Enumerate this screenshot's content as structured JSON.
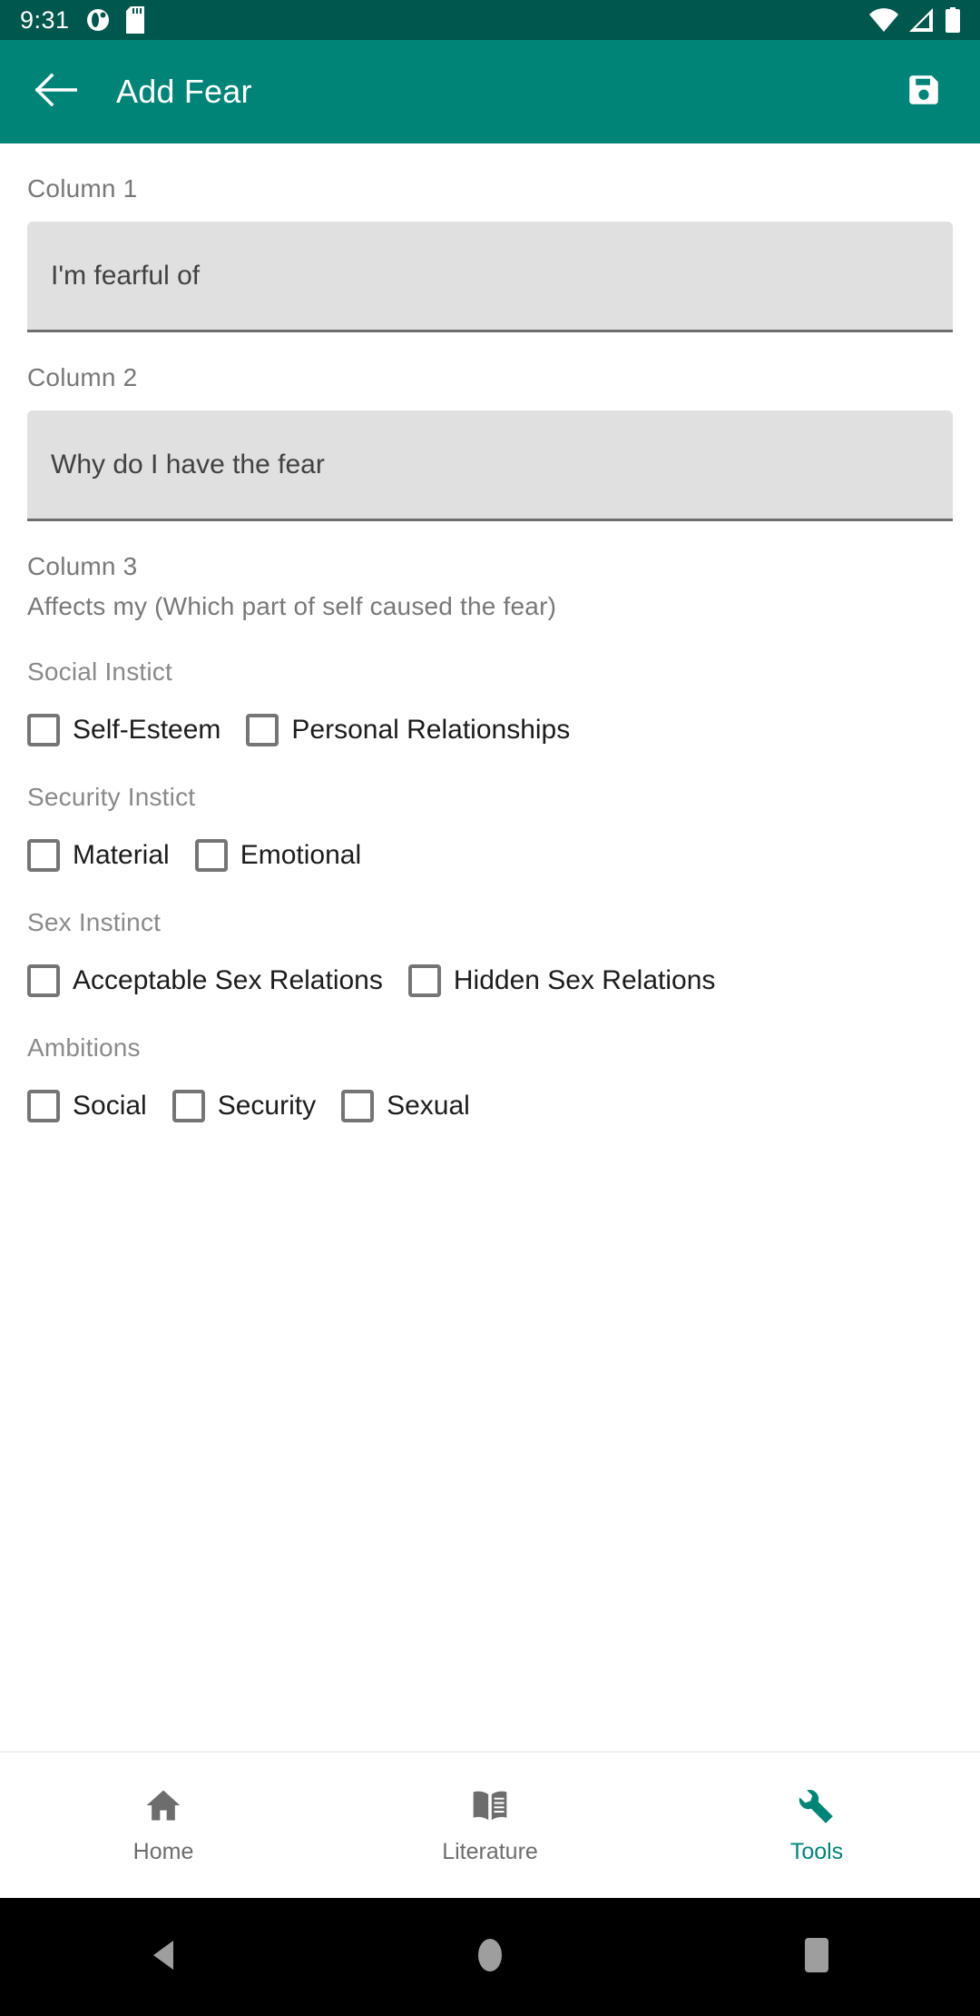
{
  "status_bar": {
    "time": "9:31",
    "icons_left": [
      "app-notification-icon",
      "sd-card-icon"
    ],
    "icons_right": [
      "wifi-icon",
      "cell-signal-icon",
      "battery-icon"
    ],
    "background_color": "#00574D"
  },
  "app_bar": {
    "back_icon": "arrow-left-icon",
    "title": "Add Fear",
    "save_icon": "save-floppy-icon",
    "background_color": "#018478"
  },
  "form": {
    "column1": {
      "label": "Column 1",
      "value": "",
      "placeholder": "I'm fearful of"
    },
    "column2": {
      "label": "Column 2",
      "value": "",
      "placeholder": "Why do I have the fear"
    },
    "column3": {
      "label": "Column 3",
      "sublabel": "Affects my (Which part of self caused the fear)",
      "groups": [
        {
          "title": "Social Instict",
          "options": [
            {
              "label": "Self-Esteem",
              "checked": false
            },
            {
              "label": "Personal Relationships",
              "checked": false
            }
          ]
        },
        {
          "title": "Security Instict",
          "options": [
            {
              "label": "Material",
              "checked": false
            },
            {
              "label": "Emotional",
              "checked": false
            }
          ]
        },
        {
          "title": "Sex Instinct",
          "options": [
            {
              "label": "Acceptable Sex Relations",
              "checked": false
            },
            {
              "label": "Hidden Sex Relations",
              "checked": false
            }
          ]
        },
        {
          "title": "Ambitions",
          "options": [
            {
              "label": "Social",
              "checked": false
            },
            {
              "label": "Security",
              "checked": false
            },
            {
              "label": "Sexual",
              "checked": false
            }
          ]
        }
      ]
    }
  },
  "bottom_nav": {
    "active_color": "#018478",
    "inactive_color": "#6d6d6d",
    "items": [
      {
        "label": "Home",
        "icon": "home-icon",
        "active": false
      },
      {
        "label": "Literature",
        "icon": "book-icon",
        "active": false
      },
      {
        "label": "Tools",
        "icon": "wrench-icon",
        "active": true
      }
    ]
  },
  "android_nav": {
    "items": [
      {
        "icon": "system-back-icon"
      },
      {
        "icon": "system-home-icon"
      },
      {
        "icon": "system-recents-icon"
      }
    ]
  }
}
